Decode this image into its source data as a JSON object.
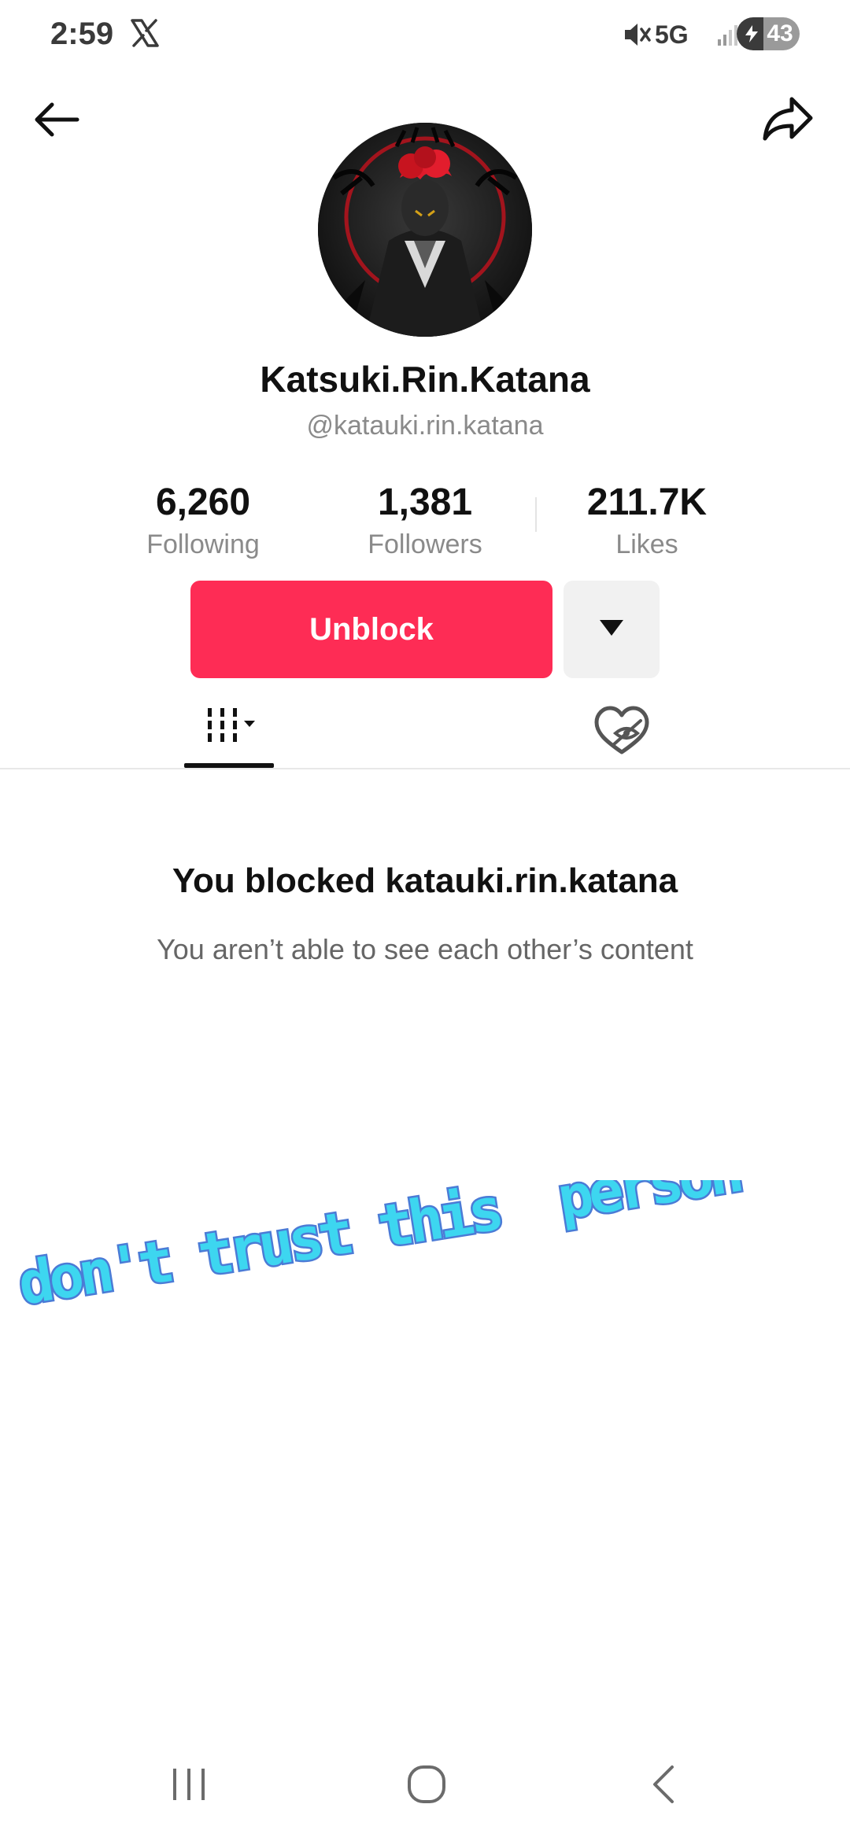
{
  "status_bar": {
    "time": "2:59",
    "network": "5G",
    "battery": "43",
    "icons": [
      "x-logo-icon",
      "mute-icon",
      "signal-icon",
      "battery-icon"
    ]
  },
  "profile": {
    "display_name": "Katsuki.Rin.Katana",
    "handle": "@katauki.rin.katana",
    "stats": [
      {
        "value": "6,260",
        "label": "Following"
      },
      {
        "value": "1,381",
        "label": "Followers"
      },
      {
        "value": "211.7K",
        "label": "Likes"
      }
    ]
  },
  "actions": {
    "unblock_label": "Unblock"
  },
  "empty_state": {
    "title": "You blocked katauki.rin.katana",
    "subtitle": "You aren’t able to see each other’s content"
  },
  "overlay": {
    "sticker_text": "don't trust this  person"
  },
  "colors": {
    "accent": "#fe2c55",
    "sticker_fill": "#3dd6f0",
    "sticker_stroke": "#4b7bd6"
  }
}
